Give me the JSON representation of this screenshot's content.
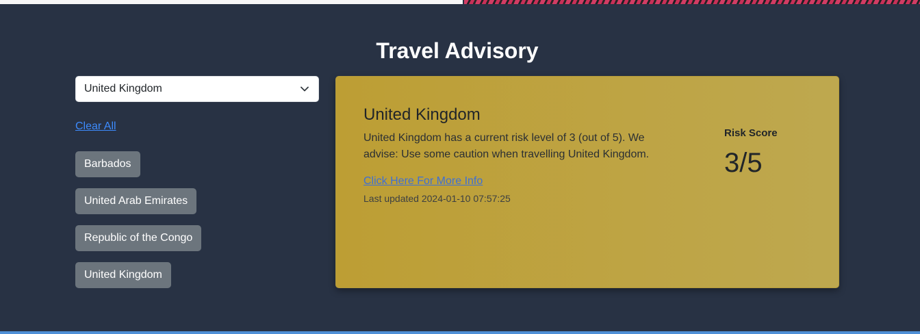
{
  "header": {
    "title": "Travel Advisory"
  },
  "select": {
    "value": "United Kingdom",
    "icon": "chevron-down-icon"
  },
  "sidebar": {
    "clear_all": "Clear All",
    "chips": [
      "Barbados",
      "United Arab Emirates",
      "Republic of the Congo",
      "United Kingdom"
    ]
  },
  "card": {
    "title": "United Kingdom",
    "description": "United Kingdom has a current risk level of 3 (out of 5). We advise: Use some caution when travelling United Kingdom.",
    "link": "Click Here For More Info",
    "updated": "Last updated 2024-01-10 07:57:25",
    "risk_label": "Risk Score",
    "risk_score": "3/5",
    "color": "#bd9e34"
  },
  "colors": {
    "background": "#283244",
    "chip": "#6c757d",
    "link": "#3d8bfd"
  }
}
